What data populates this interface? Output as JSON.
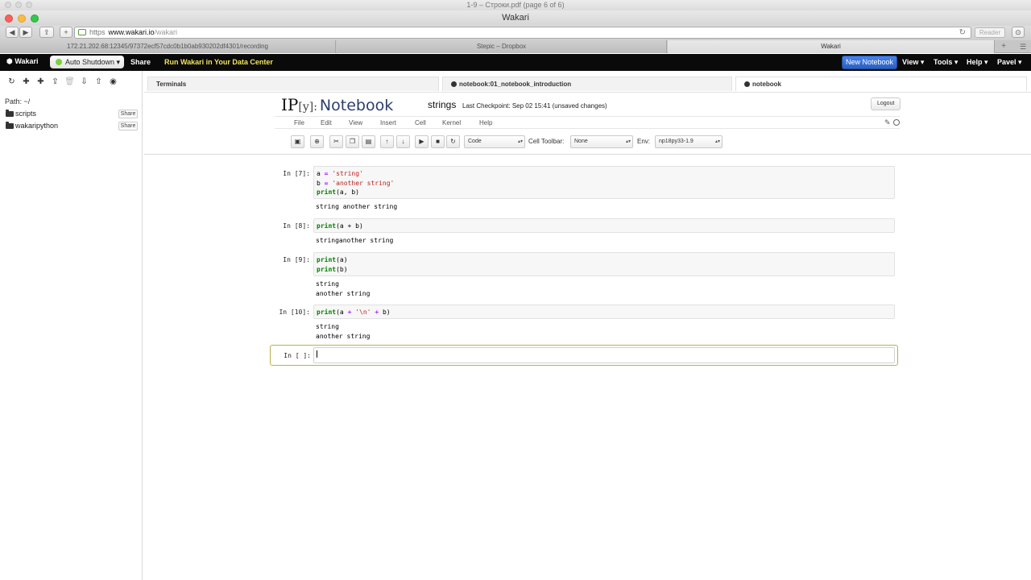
{
  "os_window_title": "1-9 – Строки.pdf (page 6 of 6)",
  "browser": {
    "window_title": "Wakari",
    "url_https": "https",
    "url_host": "www.wakari.io",
    "url_path": "/wakari",
    "reader_label": "Reader",
    "tabs": [
      {
        "label": "172.21.202.68:12345/97372ecf57cdc0b1b0ab930202df4301/recording"
      },
      {
        "label": "Stepic – Dropbox"
      },
      {
        "label": "Wakari"
      }
    ]
  },
  "wakari_nav": {
    "logo": "Wakari",
    "auto_shutdown": "Auto Shutdown",
    "share": "Share",
    "run_wakari": "Run Wakari in Your Data Center",
    "new_notebook": "New Notebook",
    "menus": [
      "View",
      "Tools",
      "Help",
      "Pavel"
    ]
  },
  "sidebar": {
    "path": "Path: ~/",
    "items": [
      {
        "name": "scripts",
        "share": "Share"
      },
      {
        "name": "wakaripython",
        "share": "Share"
      }
    ]
  },
  "main_tabs": [
    {
      "label": "Terminals"
    },
    {
      "label": "notebook:01_notebook_introduction"
    },
    {
      "label": "notebook"
    }
  ],
  "notebook": {
    "logo_ip": "IP",
    "logo_y": "[y]:",
    "logo_nb": "Notebook",
    "name": "strings",
    "checkpoint": "Last Checkpoint: Sep 02 15:41 (unsaved changes)",
    "logout": "Logout",
    "menu": [
      "File",
      "Edit",
      "View",
      "Insert",
      "Cell",
      "Kernel",
      "Help"
    ],
    "cell_type": "Code",
    "cell_toolbar_label": "Cell Toolbar:",
    "cell_toolbar_value": "None",
    "env_label": "Env:",
    "env_value": "np18py33-1.9"
  },
  "cells": [
    {
      "prompt": "In [7]:",
      "output": "string another string"
    },
    {
      "prompt": "In [8]:",
      "output": "stringanother string"
    },
    {
      "prompt": "In [9]:",
      "output": "string\nanother string"
    },
    {
      "prompt": "In [10]:",
      "output": "string\nanother string"
    },
    {
      "prompt": "In [ ]:"
    }
  ],
  "code": {
    "c7_l1_a": "a",
    "c7_l1_s": "'string'",
    "c7_l2_b": "b",
    "c7_l2_s": "'another string'",
    "c7_l3_fn": "print",
    "c7_l3_args": "(a, b)",
    "c8_fn": "print",
    "c8_args": "(a + b)",
    "c9_l1_fn": "print",
    "c9_l1_args": "(a)",
    "c9_l2_fn": "print",
    "c9_l2_args": "(b)",
    "c10_fn": "print",
    "c10_a": "(a",
    "c10_s": "'\\n'",
    "c10_b": "b)"
  }
}
